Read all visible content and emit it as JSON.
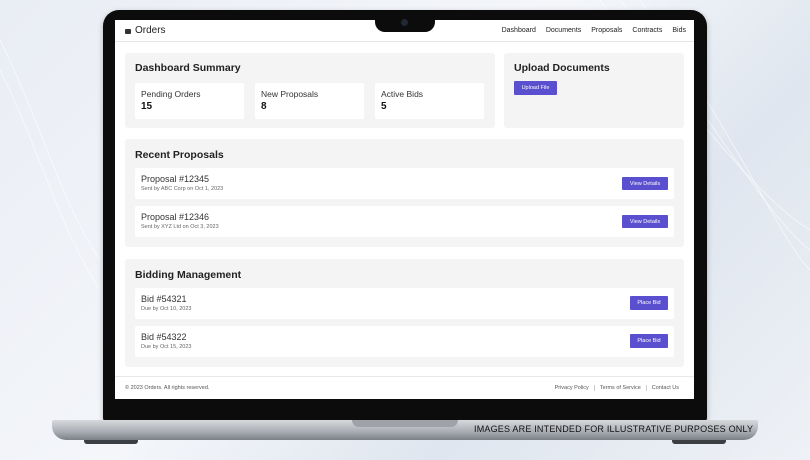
{
  "app": {
    "title": "Orders"
  },
  "nav": {
    "items": [
      "Dashboard",
      "Documents",
      "Proposals",
      "Contracts",
      "Bids"
    ]
  },
  "summary": {
    "title": "Dashboard Summary",
    "stats": [
      {
        "label": "Pending Orders",
        "value": "15"
      },
      {
        "label": "New Proposals",
        "value": "8"
      },
      {
        "label": "Active Bids",
        "value": "5"
      }
    ]
  },
  "upload": {
    "title": "Upload Documents",
    "button": "Upload File"
  },
  "proposals": {
    "title": "Recent Proposals",
    "items": [
      {
        "title": "Proposal #12345",
        "sub": "Sent by ABC Corp on Oct 1, 2023",
        "button": "View Details"
      },
      {
        "title": "Proposal #12346",
        "sub": "Sent by XYZ Ltd on Oct 3, 2023",
        "button": "View Details"
      }
    ]
  },
  "bidding": {
    "title": "Bidding Management",
    "items": [
      {
        "title": "Bid #54321",
        "sub": "Due by Oct 10, 2023",
        "button": "Place Bid"
      },
      {
        "title": "Bid #54322",
        "sub": "Due by Oct 15, 2023",
        "button": "Place Bid"
      }
    ]
  },
  "footer": {
    "copyright": "© 2023 Orders. All rights reserved.",
    "links": [
      "Privacy Policy",
      "Terms of Service",
      "Contact Us"
    ]
  },
  "disclaimer": "IMAGES ARE INTENDED FOR ILLUSTRATIVE PURPOSES ONLY",
  "colors": {
    "accent": "#5a4fcf",
    "panel": "#f4f4f4"
  }
}
